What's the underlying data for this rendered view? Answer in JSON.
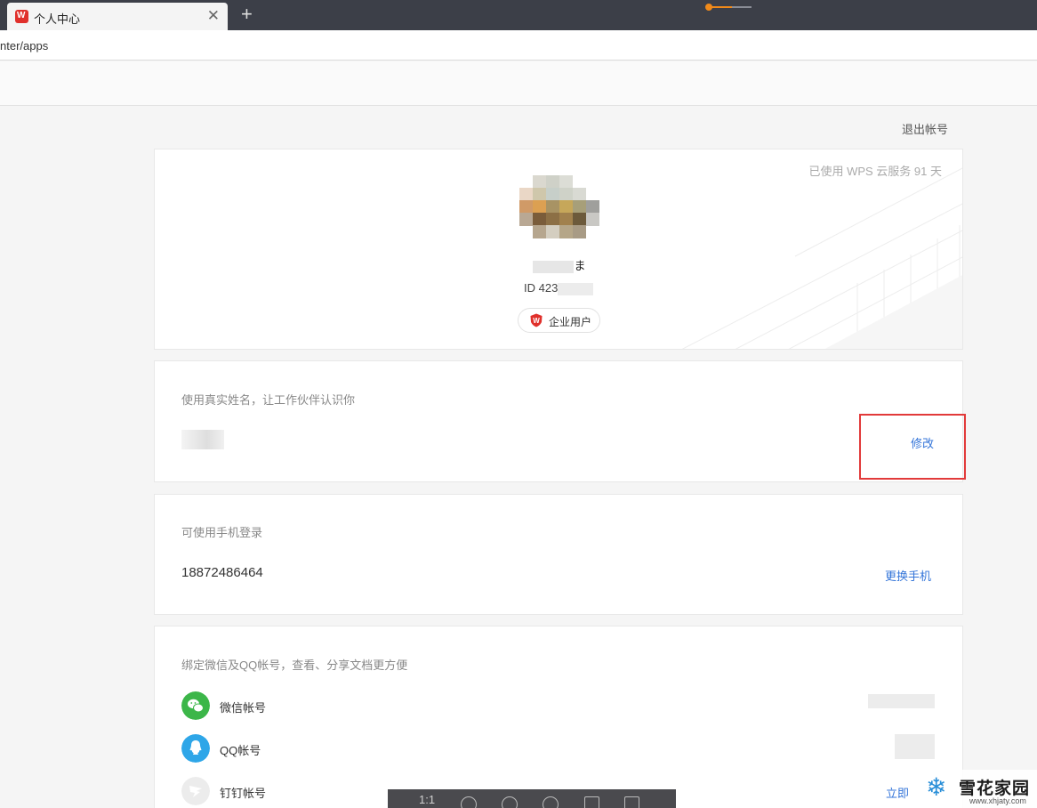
{
  "browser": {
    "tab_title": "个人中心",
    "tab_close": "✕",
    "new_tab": "+",
    "address": "nter/apps",
    "slider_value": 0.55
  },
  "header": {
    "logout": "退出帐号"
  },
  "profile": {
    "cloud_days": "已使用 WPS 云服务 91 天",
    "name_suffix": "ま",
    "id_prefix": "ID 423",
    "badge_label": "企业用户"
  },
  "name_section": {
    "title": "使用真实姓名，让工作伙伴认识你",
    "edit_link": "修改"
  },
  "phone_section": {
    "title": "可使用手机登录",
    "number": "18872486464",
    "change_link": "更换手机"
  },
  "bind_section": {
    "title": "绑定微信及QQ帐号，查看、分享文档更方便",
    "accounts": [
      {
        "label": "微信帐号",
        "icon": "wechat-icon"
      },
      {
        "label": "QQ帐号",
        "icon": "qq-icon"
      },
      {
        "label": "钉钉帐号",
        "icon": "dingtalk-icon",
        "action": "立即"
      }
    ]
  },
  "viewer_toolbar": {
    "ratio_label": "1:1"
  },
  "watermark": {
    "title": "雪花家园",
    "url": "www.xhjaty.com"
  },
  "colors": {
    "accent_link": "#3475d9",
    "highlight": "#e23a3a",
    "wps_red": "#e0302b"
  }
}
